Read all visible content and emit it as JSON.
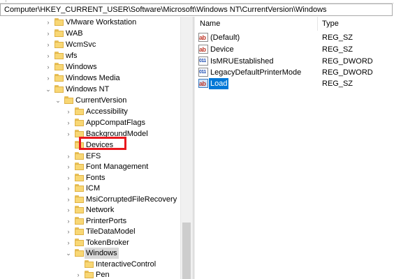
{
  "address": "Computer\\HKEY_CURRENT_USER\\Software\\Microsoft\\Windows NT\\CurrentVersion\\Windows",
  "tree": [
    {
      "label": "VMware Workstation",
      "expander": "›",
      "selected": false
    },
    {
      "label": "WAB",
      "expander": "›",
      "selected": false
    },
    {
      "label": "WcmSvc",
      "expander": "›",
      "selected": false
    },
    {
      "label": "wfs",
      "expander": "›",
      "selected": false
    },
    {
      "label": "Windows",
      "expander": "›",
      "selected": false
    },
    {
      "label": "Windows Media",
      "expander": "›",
      "selected": false
    },
    {
      "label": "Windows NT",
      "expander": "⌄",
      "selected": false
    },
    {
      "label": "CurrentVersion",
      "expander": "⌄",
      "selected": false
    },
    {
      "label": "Accessibility",
      "expander": "›",
      "selected": false
    },
    {
      "label": "AppCompatFlags",
      "expander": "›",
      "selected": false
    },
    {
      "label": "BackgroundModel",
      "expander": "›",
      "selected": false
    },
    {
      "label": "Devices",
      "expander": "",
      "selected": false
    },
    {
      "label": "EFS",
      "expander": "›",
      "selected": false
    },
    {
      "label": "Font Management",
      "expander": "›",
      "selected": false
    },
    {
      "label": "Fonts",
      "expander": "›",
      "selected": false
    },
    {
      "label": "ICM",
      "expander": "›",
      "selected": false
    },
    {
      "label": "MsiCorruptedFileRecovery",
      "expander": "›",
      "selected": false
    },
    {
      "label": "Network",
      "expander": "›",
      "selected": false
    },
    {
      "label": "PrinterPorts",
      "expander": "›",
      "selected": false
    },
    {
      "label": "TileDataModel",
      "expander": "›",
      "selected": false
    },
    {
      "label": "TokenBroker",
      "expander": "›",
      "selected": false
    },
    {
      "label": "Windows",
      "expander": "⌄",
      "selected": true
    },
    {
      "label": "InteractiveControl",
      "expander": "",
      "selected": false
    },
    {
      "label": "Pen",
      "expander": "›",
      "selected": false
    }
  ],
  "list": {
    "columns": {
      "name": "Name",
      "type": "Type"
    },
    "rows": [
      {
        "name": "(Default)",
        "type": "REG_SZ",
        "icon": "string-value-icon",
        "icon_text": "ab",
        "selected": false
      },
      {
        "name": "Device",
        "type": "REG_SZ",
        "icon": "string-value-icon",
        "icon_text": "ab",
        "selected": false
      },
      {
        "name": "IsMRUEstablished",
        "type": "REG_DWORD",
        "icon": "dword-value-icon",
        "icon_text": "011",
        "selected": false
      },
      {
        "name": "LegacyDefaultPrinterMode",
        "type": "REG_DWORD",
        "icon": "dword-value-icon",
        "icon_text": "011",
        "selected": false
      },
      {
        "name": "Load",
        "type": "REG_SZ",
        "icon": "string-value-icon",
        "icon_text": "ab",
        "selected": true
      }
    ]
  }
}
